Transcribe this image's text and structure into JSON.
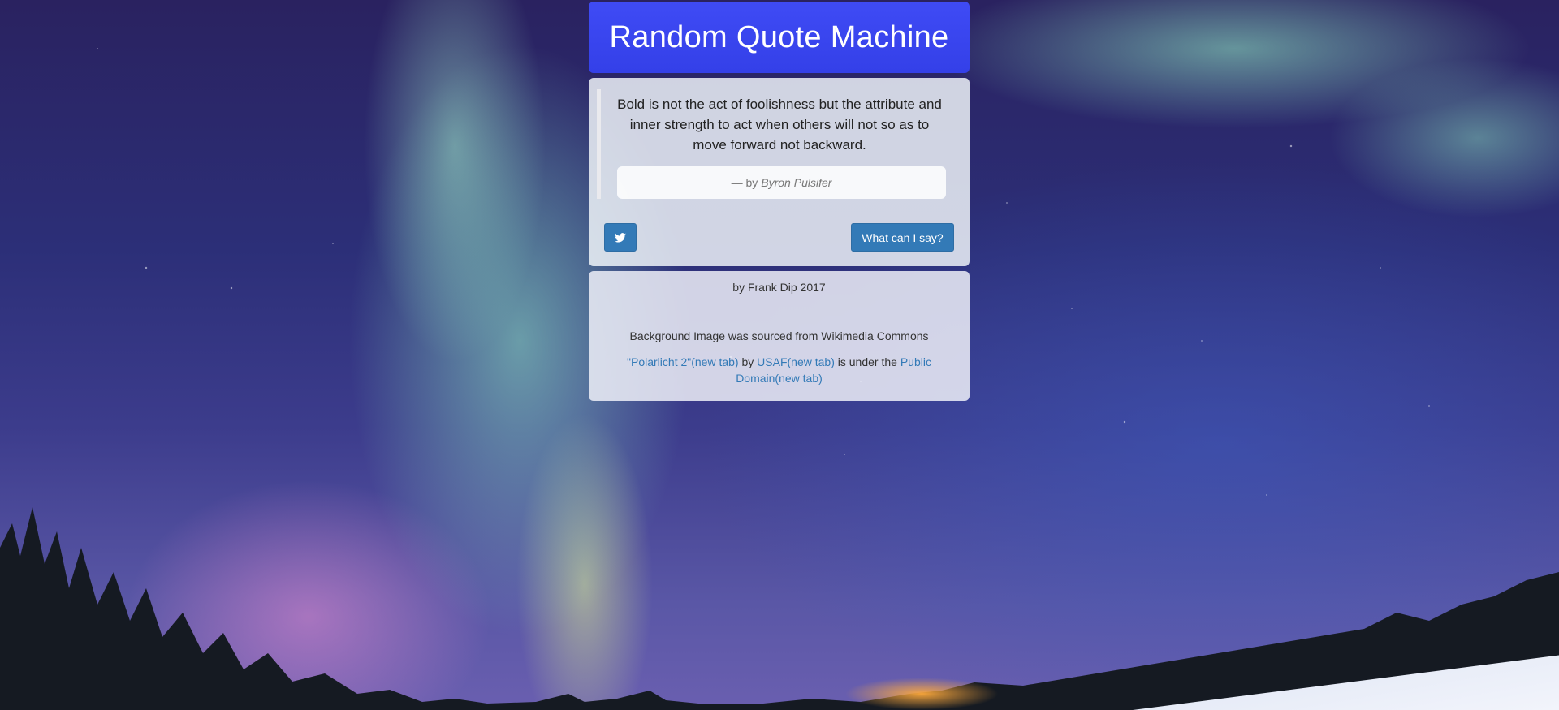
{
  "header": {
    "title": "Random Quote Machine"
  },
  "quote": {
    "text": "Bold is not the act of foolishness but the attribute and inner strength to act when others will not so as to move forward not backward.",
    "author_prefix": "— by",
    "author_name": "Byron Pulsifer"
  },
  "buttons": {
    "tweet_icon": "twitter-icon",
    "new_quote_label": "What can I say?"
  },
  "footer": {
    "credit": "by Frank Dip 2017",
    "source_text": "Background Image was sourced from Wikimedia Commons",
    "license": {
      "image_link": "\"Polarlicht 2\"(new tab)",
      "by_text": "by",
      "author_link": "USAF(new tab)",
      "under_text": "is under the",
      "license_link": "Public Domain(new tab)"
    }
  },
  "colors": {
    "header_bg": "#3b44f0",
    "button_bg": "#337ab7",
    "link": "#337ab7"
  }
}
